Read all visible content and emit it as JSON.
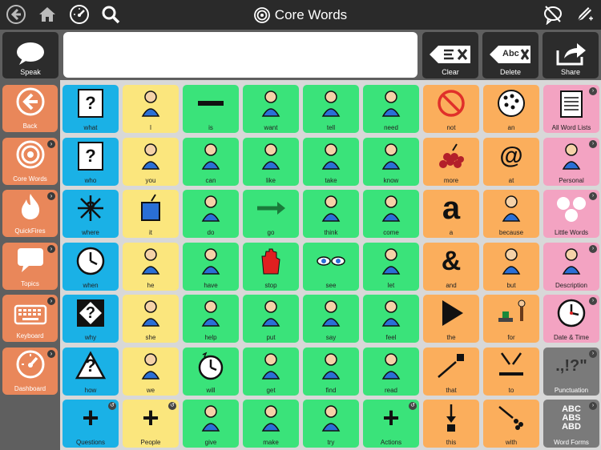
{
  "app": {
    "title": "Core Words"
  },
  "toolbar": {
    "speak_label": "Speak",
    "clear_label": "Clear",
    "delete_label": "Delete",
    "share_label": "Share",
    "delete_icon_text": "Abc"
  },
  "message": {
    "text": ""
  },
  "nav": [
    {
      "label": "Back"
    },
    {
      "label": "Core Words"
    },
    {
      "label": "QuickFires"
    },
    {
      "label": "Topics"
    },
    {
      "label": "Keyboard"
    },
    {
      "label": "Dashboard"
    }
  ],
  "grid": {
    "rows": [
      [
        "what",
        "I",
        "is",
        "want",
        "tell",
        "need",
        "not",
        "an",
        "All Word Lists"
      ],
      [
        "who",
        "you",
        "can",
        "like",
        "take",
        "know",
        "more",
        "at",
        "Personal"
      ],
      [
        "where",
        "it",
        "do",
        "go",
        "think",
        "come",
        "a",
        "because",
        "Little Words"
      ],
      [
        "when",
        "he",
        "have",
        "stop",
        "see",
        "let",
        "and",
        "but",
        "Description"
      ],
      [
        "why",
        "she",
        "help",
        "put",
        "say",
        "feel",
        "the",
        "for",
        "Date & Time"
      ],
      [
        "how",
        "we",
        "will",
        "get",
        "find",
        "read",
        "that",
        "to",
        "Punctuation"
      ],
      [
        "Questions",
        "People",
        "give",
        "make",
        "try",
        "Actions",
        "this",
        "with",
        "Word Forms"
      ]
    ],
    "glyphs": {
      "what": "?",
      "who": "?",
      "where": "?",
      "when": "",
      "why": "?",
      "how": "?",
      "Questions": "+",
      "People": "+",
      "Actions": "+",
      "a": "a",
      "and": "&",
      "at": "@",
      "Punctuation": ".,!?\"",
      "Word Forms": "ABC ABS ABD"
    }
  },
  "colors": {
    "blue": "#1ab1e6",
    "yellow": "#fbe67d",
    "green": "#3ae37a",
    "orange": "#fbae5c",
    "pink": "#f3a3c2",
    "gray": "#7a7a7a",
    "nav": "#e9875a"
  }
}
